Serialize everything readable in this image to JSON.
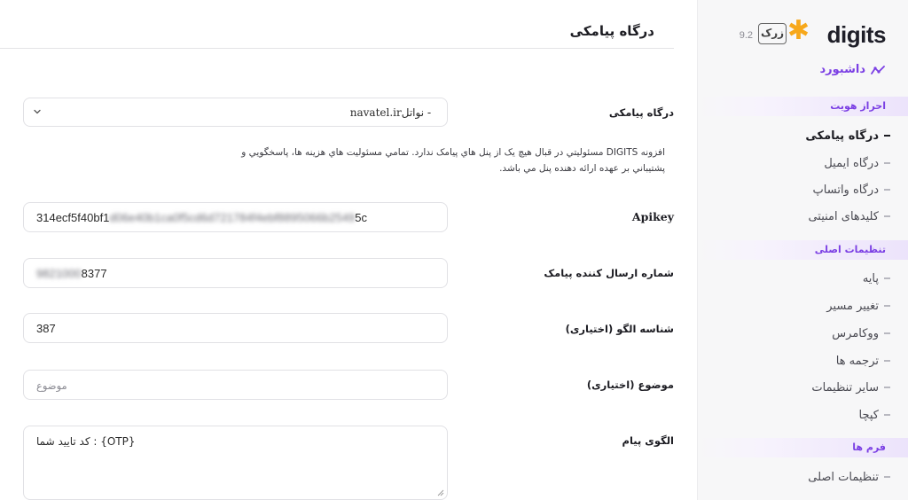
{
  "sidebar": {
    "logo": {
      "wordmark": "digits",
      "badge": "زرک",
      "version": "9.2"
    },
    "dashboard": "داشبورد",
    "sections": [
      {
        "title": "احراز هویت",
        "items": [
          "درگاه پیامکی",
          "درگاه ایمیل",
          "درگاه واتساپ",
          "کلیدهای امنیتی"
        ]
      },
      {
        "title": "تنظیمات اصلی",
        "items": [
          "پایه",
          "تغییر مسیر",
          "ووکامرس",
          "ترجمه ها",
          "سایر تنظیمات",
          "کپچا"
        ]
      },
      {
        "title": "فرم ها",
        "items": [
          "تنظیمات اصلی"
        ]
      }
    ],
    "active_item": "درگاه پیامکی"
  },
  "main": {
    "title": "درگاه پیامکی",
    "gateway": {
      "label": "درگاه پیامکی",
      "value_latin": "navatel.ir",
      "value_rest": " - نواتل"
    },
    "notice": "افزونه DIGITS مسئوليتي در قبال هيچ يک از پنل هاي پيامک ندارد. تمامي مسئوليت هاي هزينه ها، پاسخگويي و پشتيباني بر عهده ارائه دهنده پنل مي باشد.",
    "apikey": {
      "label": "Apikey",
      "value_visible": "314ecf5f40bf1",
      "value_blurred": "d06e40b1ca0f5cd6d721784f4ebf8895066b2549",
      "value_end": "5c"
    },
    "sender": {
      "label": "شماره ارسال کننده پیامک",
      "value_blurred": "9821000",
      "value_visible": "8377"
    },
    "pattern_id": {
      "label": "شناسه الگو (اختیاری)",
      "value": "387"
    },
    "subject": {
      "label": "موضوع (اختیاری)",
      "placeholder": "موضوع"
    },
    "message_template": {
      "label": "الگوی پیام",
      "value": "{OTP}  : کد تایید شما"
    }
  },
  "colors": {
    "accent": "#7b3fe4",
    "logo_star": "#f7a81b",
    "sidebar_bg": "#f7f7f8"
  }
}
